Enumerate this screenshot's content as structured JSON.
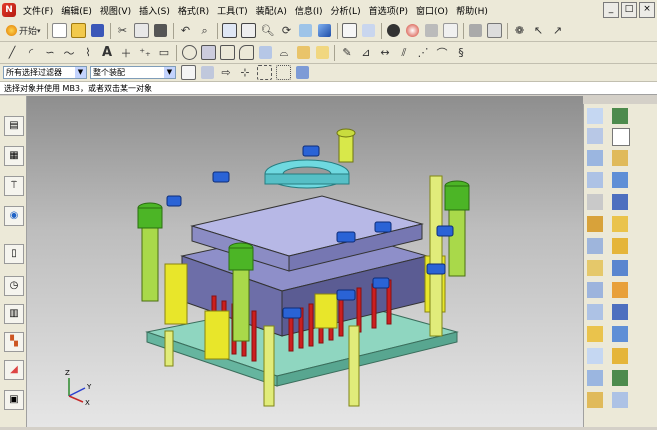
{
  "menubar": {
    "items": [
      "文件(F)",
      "编辑(E)",
      "视图(V)",
      "插入(S)",
      "格式(R)",
      "工具(T)",
      "装配(A)",
      "信息(I)",
      "分析(L)",
      "首选项(P)",
      "窗口(O)",
      "帮助(H)"
    ],
    "window_controls": [
      "_",
      "□",
      "×"
    ]
  },
  "toolbar1": {
    "start_label": "开始",
    "start_icon": "start-icon",
    "icons": [
      "new-icon",
      "open-icon",
      "save-icon",
      "cut-icon",
      "copy-icon",
      "paste-icon",
      "undo-icon",
      "command-finder-icon",
      "fit-icon",
      "zoom-icon",
      "rotate-icon",
      "pan-icon",
      "shaded-icon",
      "wireframe-icon",
      "view-orient-icon",
      "help-icon",
      "render-icon",
      "layer-icon",
      "material-icon"
    ]
  },
  "toolbar2": {
    "icons": [
      "line-icon",
      "arc-icon",
      "spline-icon",
      "curve-icon",
      "text-icon",
      "point-icon",
      "point-set-icon",
      "rectangle-icon",
      "offset-icon",
      "trim-icon",
      "extend-icon",
      "fillet-icon",
      "section-icon",
      "bridge-icon",
      "join-icon",
      "project-icon"
    ]
  },
  "toolbar3": {
    "filter_value": "所有选择过滤器",
    "scope_value": "整个装配"
  },
  "status": {
    "text": "选择对象并使用 MB3，或者双击某一对象"
  },
  "viewport": {
    "triad_axes": [
      "X",
      "Y",
      "Z"
    ],
    "colors": {
      "base_plate": "#8fd6c0",
      "mold_plate": "#6d6ea8",
      "pin": "#cc1f1f",
      "spring": "#e8e62a",
      "guide_pillar": "#4cb526",
      "screw": "#2a63d6",
      "locating_ring": "#6fd9e0"
    }
  },
  "left_bar": {
    "icons": [
      "assembly-navigator-icon",
      "part-navigator-icon",
      "reuse-library-icon",
      "web-browser-icon",
      "history-icon",
      "system-materials-icon",
      "process-studio-icon",
      "roles-icon"
    ]
  },
  "right_panel": {
    "icons": [
      "extrude-icon",
      "revolve-icon",
      "hole-icon",
      "boss-icon",
      "pocket-icon",
      "pad-icon",
      "slot-icon",
      "groove-icon",
      "thread-icon",
      "edge-blend-icon",
      "chamfer-icon",
      "shell-icon",
      "draft-icon",
      "pattern-icon",
      "mirror-icon",
      "trim-body-icon",
      "split-body-icon",
      "unite-icon",
      "subtract-icon",
      "intersect-icon"
    ]
  }
}
